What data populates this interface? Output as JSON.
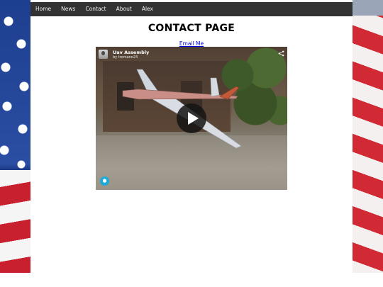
{
  "nav": {
    "items": [
      {
        "label": "Home"
      },
      {
        "label": "News"
      },
      {
        "label": "Contact"
      },
      {
        "label": "About"
      },
      {
        "label": "Alex"
      }
    ]
  },
  "page": {
    "title": "CONTACT PAGE",
    "email_link": "Email Me"
  },
  "video": {
    "title": "Uav Assembly",
    "by_prefix": "by",
    "author": "tromano24"
  },
  "colors": {
    "nav_bg": "#333333",
    "link": "#0000ee",
    "flag_red": "#c8202f",
    "flag_blue": "#1e3f8f",
    "sketchfab_blue": "#1caad9"
  }
}
